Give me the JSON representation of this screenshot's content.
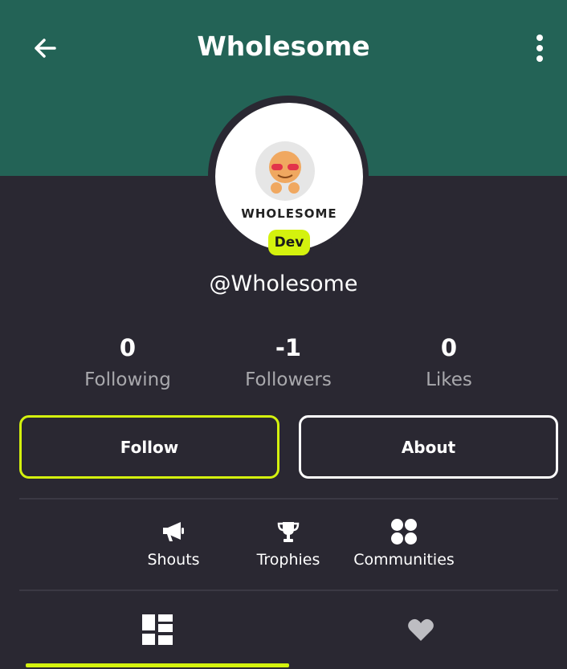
{
  "header": {
    "title": "Wholesome",
    "back_icon": "arrow-left-icon",
    "menu_icon": "more-vertical-icon",
    "background_color": "#236356"
  },
  "profile": {
    "avatar_text": "Wholesome",
    "badge": "Dev",
    "username": "@Wholesome"
  },
  "stats": [
    {
      "value": "0",
      "label": "Following"
    },
    {
      "value": "-1",
      "label": "Followers"
    },
    {
      "value": "0",
      "label": "Likes"
    }
  ],
  "actions": {
    "follow_label": "Follow",
    "about_label": "About"
  },
  "features": [
    {
      "label": "Shouts",
      "icon": "megaphone-icon"
    },
    {
      "label": "Trophies",
      "icon": "trophy-icon"
    },
    {
      "label": "Communities",
      "icon": "communities-icon"
    }
  ],
  "tabs": [
    {
      "icon": "grid-icon",
      "selected": true
    },
    {
      "icon": "heart-icon",
      "selected": false
    }
  ],
  "colors": {
    "accent": "#d4f20e",
    "background": "#2a2832",
    "muted_text": "#a9a9ad"
  }
}
